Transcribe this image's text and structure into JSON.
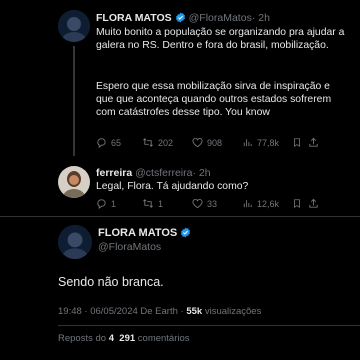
{
  "tweet1": {
    "name": "FLORA MATOS",
    "handle": "@FloraMatos",
    "time": "· 2h",
    "paragraph1": "Muito bonito a população se organizando pra ajudar a galera no RS. Dentro e fora do brasil, mobilização.",
    "paragraph2": "Espero que essa mobilização sirva de inspiração e que que aconteça  quando outros estados sofrerem com catástrofes desse tipo.  You know",
    "replies": "65",
    "reposts": "202",
    "likes": "908",
    "views": "77,8k"
  },
  "tweet2": {
    "name": "ferreira",
    "handle": "@ctsferreira",
    "time": "· 2h",
    "text": "Legal, Flora. Tá ajudando como?",
    "replies": "1",
    "reposts": "1",
    "likes": "33",
    "views": "12,6k"
  },
  "tweet3": {
    "name": "FLORA MATOS",
    "handle": "@FloraMatos",
    "text": "Sendo não branca.",
    "timestamp": "19:48 · 06/05/2024 De Earth · ",
    "views_count": "55k",
    "views_label": " visualizações",
    "reposts_label": "Reposts do ",
    "reposts_count": "4",
    "comments_count": "291",
    "comments_label": " comentários"
  },
  "colors": {
    "verified": "#1d9bf0",
    "muted": "#71767b",
    "text": "#e7e9ea"
  }
}
